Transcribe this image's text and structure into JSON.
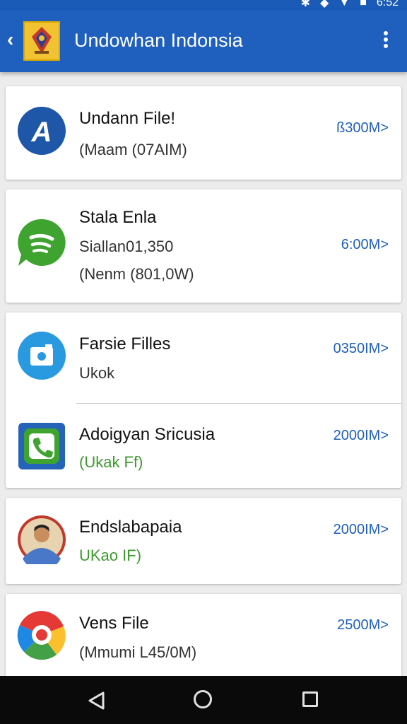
{
  "status_bar": {
    "time": "6:52"
  },
  "app_bar": {
    "title": "Undowhan Indonsia"
  },
  "items": [
    {
      "title": "Undann File!",
      "sub1": "(Maam (07AIM)",
      "size": "ß300M>",
      "icon": "a-letter-app-icon"
    },
    {
      "title": "Stala Enla",
      "sub1": "Siallan01,350",
      "sub2": "(Nenm (801,0W)",
      "size": "6:00M>",
      "icon": "chat-bubble-app-icon"
    },
    {
      "title": "Farsie Filles",
      "sub1": "Ukok",
      "size": "0350IM>",
      "icon": "camera-app-icon"
    },
    {
      "title": "Adoigyan Sricusia",
      "sub1": "(Ukak Ff)",
      "size": "2000IM>",
      "icon": "phone-app-icon"
    },
    {
      "title": "Endslabapaia",
      "sub1": "UKao IF)",
      "size": "2000IM>",
      "icon": "person-photo-avatar"
    },
    {
      "title": "Vens File",
      "sub1": "(Mmumi L45/0M)",
      "size": "2500M>",
      "icon": "colorful-wheel-app-icon"
    }
  ],
  "colors": {
    "primary": "#1f5fbd",
    "accent_green": "#3c9a2d",
    "background": "#ececec"
  }
}
